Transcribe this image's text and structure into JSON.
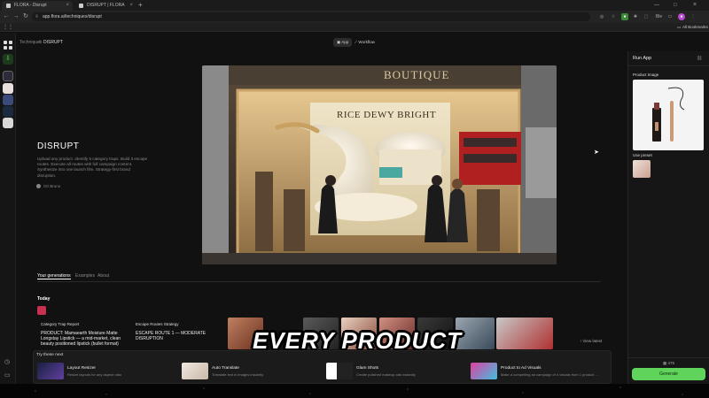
{
  "browser": {
    "tabs": [
      {
        "label": "FLORA - Disrupt"
      },
      {
        "label": "DISRUPT | FLORA"
      }
    ],
    "url": "app.flora.ai/techniques/disrupt",
    "bookmarks_label": "All Bookmarks"
  },
  "header": {
    "breadcrumb_root": "Techniques",
    "breadcrumb_sep": "/",
    "breadcrumb_current": "DISRUPT",
    "toggle_app": "App",
    "toggle_workflow": "Workflow"
  },
  "hero": {
    "store_sign": "BOUTIQUE",
    "billboard_text": "RICE DEWY BRIGHT"
  },
  "technique": {
    "title": "DISRUPT",
    "description": "Upload any product. Identify 5 category traps. Build 3 escape routes. Execute all routes with full campaign content. Synthesize into one launch film. Strategy-first brand disruption.",
    "author": "Ori Bruno"
  },
  "generations": {
    "tabs": [
      "Your generations",
      "Examples",
      "About"
    ],
    "today_label": "Today",
    "cards": [
      {
        "tag": "Category Trap Report",
        "text": "PRODUCT: Mamaearth Moisture Matte Longstay Lipstick — a mid-market, clean beauty positioned lipstick (bullet format)"
      },
      {
        "tag": "Escape Routes Strategy",
        "text": "ESCAPE ROUTE 1 — MODERATE DISRUPTION"
      }
    ],
    "view_latest": "View latest"
  },
  "caption": "EVERY PRODUCT",
  "try_these": {
    "label": "Try these next",
    "tools": [
      {
        "name": "Layout Resizer",
        "desc": "Resize layouts for any aspect ratio"
      },
      {
        "name": "Auto Translate",
        "desc": "Translate text in images instantly"
      },
      {
        "name": "Glam Shots",
        "desc": "Create polished makeup ads instantly"
      },
      {
        "name": "Product to Ad Visuals",
        "desc": "Make a compelling ad campaign of 4 visuals from 1 product ..."
      }
    ]
  },
  "run_panel": {
    "title": "Run App",
    "product_image_label": "Product Image",
    "use_preset_label": "Use preset",
    "credits": "475",
    "generate_label": "Generate"
  },
  "colors": {
    "accent_green": "#5fd35a",
    "background": "#111111"
  }
}
